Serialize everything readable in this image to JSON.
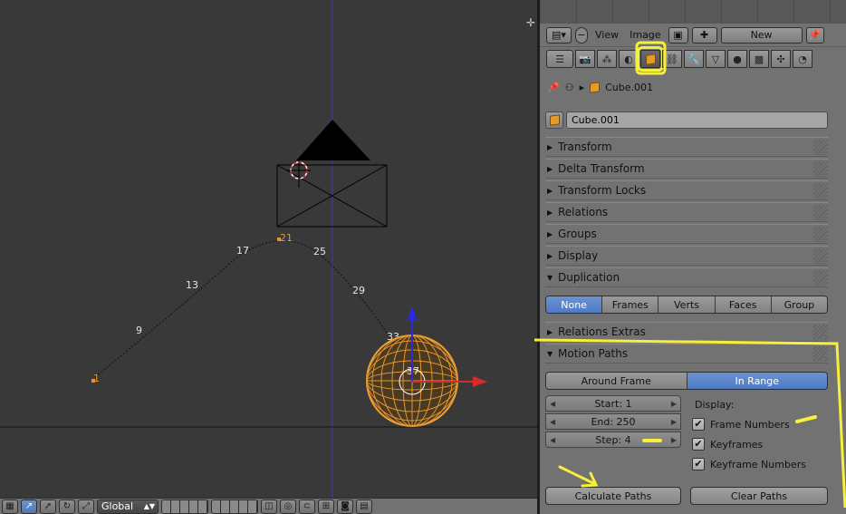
{
  "viewport": {
    "frame_labels": [
      "1",
      "9",
      "13",
      "17",
      "21",
      "25",
      "29",
      "33",
      "37"
    ],
    "header": {
      "orientation": "Global",
      "icons": [
        "view-mode-icon",
        "move-icon",
        "rotate-icon",
        "scale-icon",
        "layers-grid",
        "snap-icon",
        "proportional-icon",
        "render-icon",
        "clapper-icon"
      ]
    }
  },
  "image_header": {
    "view_label": "View",
    "image_label": "Image",
    "new_label": "New"
  },
  "context_tabs": [
    "render",
    "render-layers",
    "scene",
    "world",
    "object",
    "constraints",
    "modifiers",
    "data",
    "material",
    "texture",
    "particles",
    "physics"
  ],
  "breadcrumb": {
    "object": "Cube.001"
  },
  "object_name": "Cube.001",
  "panels": {
    "transform": "Transform",
    "delta_transform": "Delta Transform",
    "transform_locks": "Transform Locks",
    "relations": "Relations",
    "groups": "Groups",
    "display": "Display",
    "duplication": "Duplication",
    "relations_extras": "Relations Extras",
    "motion_paths": "Motion Paths"
  },
  "duplication_options": [
    "None",
    "Frames",
    "Verts",
    "Faces",
    "Group"
  ],
  "duplication_selected": "None",
  "motion_paths": {
    "range_options": [
      "Around Frame",
      "In Range"
    ],
    "range_selected": "In Range",
    "start": "Start: 1",
    "end": "End: 250",
    "step": "Step: 4",
    "display_label": "Display:",
    "checks": [
      {
        "label": "Frame Numbers",
        "checked": true
      },
      {
        "label": "Keyframes",
        "checked": true
      },
      {
        "label": "Keyframe Numbers",
        "checked": true
      }
    ],
    "calculate_label": "Calculate Paths",
    "clear_label": "Clear Paths"
  },
  "colors": {
    "highlight": "#f6f03a",
    "selected_blue": "#5a86cc",
    "object_orange": "#e5952e"
  }
}
